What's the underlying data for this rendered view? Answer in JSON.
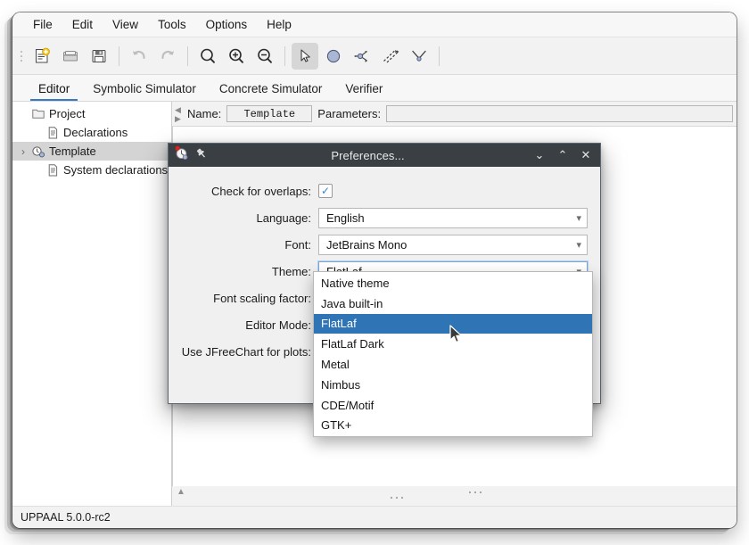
{
  "window": {
    "menubar": [
      "File",
      "Edit",
      "View",
      "Tools",
      "Options",
      "Help"
    ],
    "toolbar": [
      {
        "name": "new-document-icon",
        "title": "New"
      },
      {
        "name": "open-folder-icon",
        "title": "Open"
      },
      {
        "name": "save-floppy-icon",
        "title": "Save"
      },
      {
        "name": "undo-arrow-icon",
        "title": "Undo"
      },
      {
        "name": "redo-arrow-icon",
        "title": "Redo"
      },
      {
        "name": "zoom-fit-icon",
        "title": "Zoom"
      },
      {
        "name": "zoom-in-icon",
        "title": "Zoom In"
      },
      {
        "name": "zoom-out-icon",
        "title": "Zoom Out"
      },
      {
        "name": "select-pointer-icon",
        "title": "Selection tool"
      },
      {
        "name": "location-circle-icon",
        "title": "Location tool"
      },
      {
        "name": "branchpoint-icon",
        "title": "Branch point tool"
      },
      {
        "name": "edge-tool-icon",
        "title": "Edge tool"
      },
      {
        "name": "nail-tool-icon",
        "title": "Nail tool"
      }
    ],
    "tabs": [
      {
        "label": "Editor",
        "active": true
      },
      {
        "label": "Symbolic Simulator",
        "active": false
      },
      {
        "label": "Concrete Simulator",
        "active": false
      },
      {
        "label": "Verifier",
        "active": false
      }
    ],
    "tree": [
      {
        "label": "Project",
        "icon": "folder-icon",
        "indent": 0,
        "expander": "",
        "selected": false
      },
      {
        "label": "Declarations",
        "icon": "document-icon",
        "indent": 1,
        "expander": "",
        "selected": false
      },
      {
        "label": "Template",
        "icon": "template-icon",
        "indent": 1,
        "expander": "›",
        "selected": true
      },
      {
        "label": "System declarations",
        "icon": "document-icon",
        "indent": 1,
        "expander": "",
        "selected": false
      }
    ],
    "editor": {
      "name_label": "Name:",
      "name_value": "Template",
      "parameters_label": "Parameters:",
      "parameters_value": ""
    },
    "statusbar": "UPPAAL 5.0.0-rc2"
  },
  "dialog": {
    "title": "Preferences...",
    "icon": "uppaal-logo-icon",
    "pin_icon": "pin-icon",
    "buttons": {
      "minimize": "⌄",
      "maximize": "⌃",
      "close": "✕"
    },
    "fields": [
      {
        "label": "Check for overlaps:",
        "type": "checkbox",
        "checked": true,
        "name": "check-for-overlaps"
      },
      {
        "label": "Language:",
        "type": "combo",
        "value": "English",
        "name": "language"
      },
      {
        "label": "Font:",
        "type": "combo",
        "value": "JetBrains Mono",
        "name": "font"
      },
      {
        "label": "Theme:",
        "type": "combo",
        "value": "FlatLaf",
        "name": "theme",
        "focused": true
      },
      {
        "label": "Font scaling factor:",
        "type": "combo",
        "value": "",
        "name": "font-scaling-factor"
      },
      {
        "label": "Editor Mode:",
        "type": "combo",
        "value": "",
        "name": "editor-mode"
      },
      {
        "label": "Use JFreeChart for plots:",
        "type": "combo",
        "value": "",
        "name": "use-jfreechart-for-plots"
      }
    ]
  },
  "theme_dropdown": {
    "options": [
      {
        "label": "Native theme",
        "highlighted": false
      },
      {
        "label": "Java built-in",
        "highlighted": false
      },
      {
        "label": "FlatLaf",
        "highlighted": true
      },
      {
        "label": "FlatLaf Dark",
        "highlighted": false
      },
      {
        "label": "Metal",
        "highlighted": false
      },
      {
        "label": "Nimbus",
        "highlighted": false
      },
      {
        "label": "CDE/Motif",
        "highlighted": false
      },
      {
        "label": "GTK+",
        "highlighted": false
      }
    ],
    "highlight_color": "#2f74b5"
  }
}
